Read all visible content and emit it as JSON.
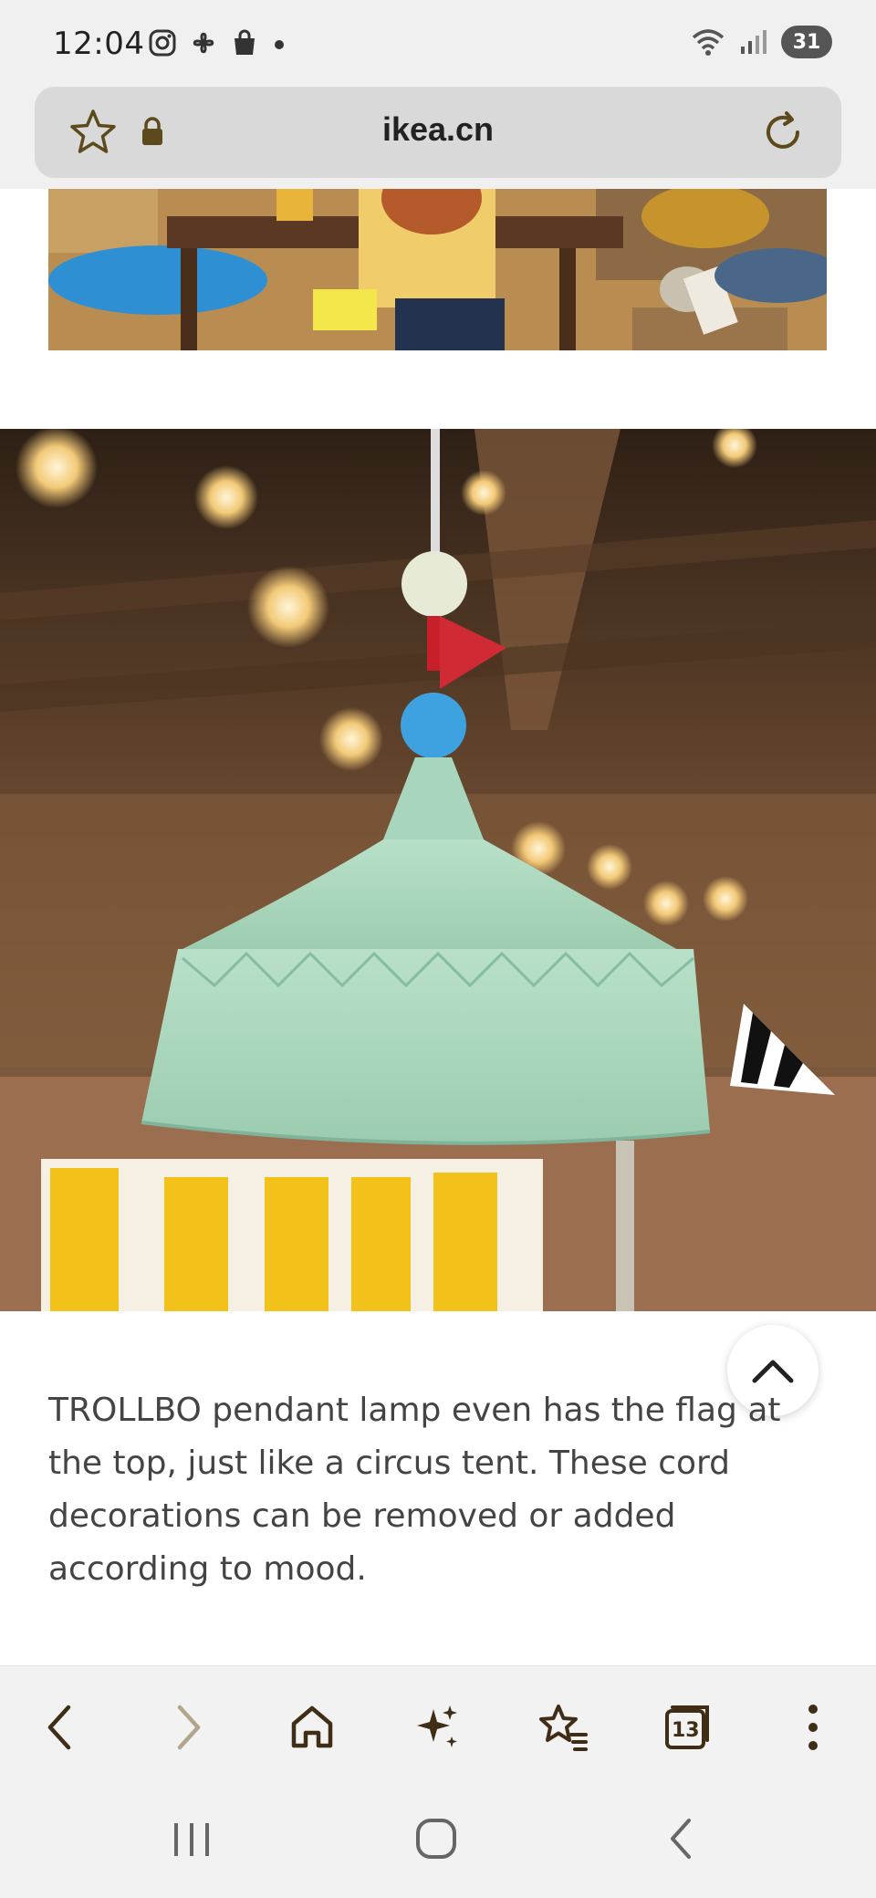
{
  "status_bar": {
    "time": "12:04",
    "battery": "31",
    "left_icons": [
      "instagram-icon",
      "pinwheel-icon",
      "shopping-bag-icon",
      "dot-icon"
    ],
    "right_icons": [
      "wifi-icon",
      "signal-icon"
    ]
  },
  "browser": {
    "url": "ikea.cn",
    "tab_count": "13"
  },
  "content": {
    "top_image_alt": "",
    "hero_image_alt": "",
    "caption": "TROLLBO pendant lamp even has the flag at the top, just like a circus tent. These cord decorations can be removed or added according to mood."
  },
  "colors": {
    "accent_icon": "#5c4a1c",
    "text": "#444444",
    "lamp": "#a8d5bd"
  }
}
